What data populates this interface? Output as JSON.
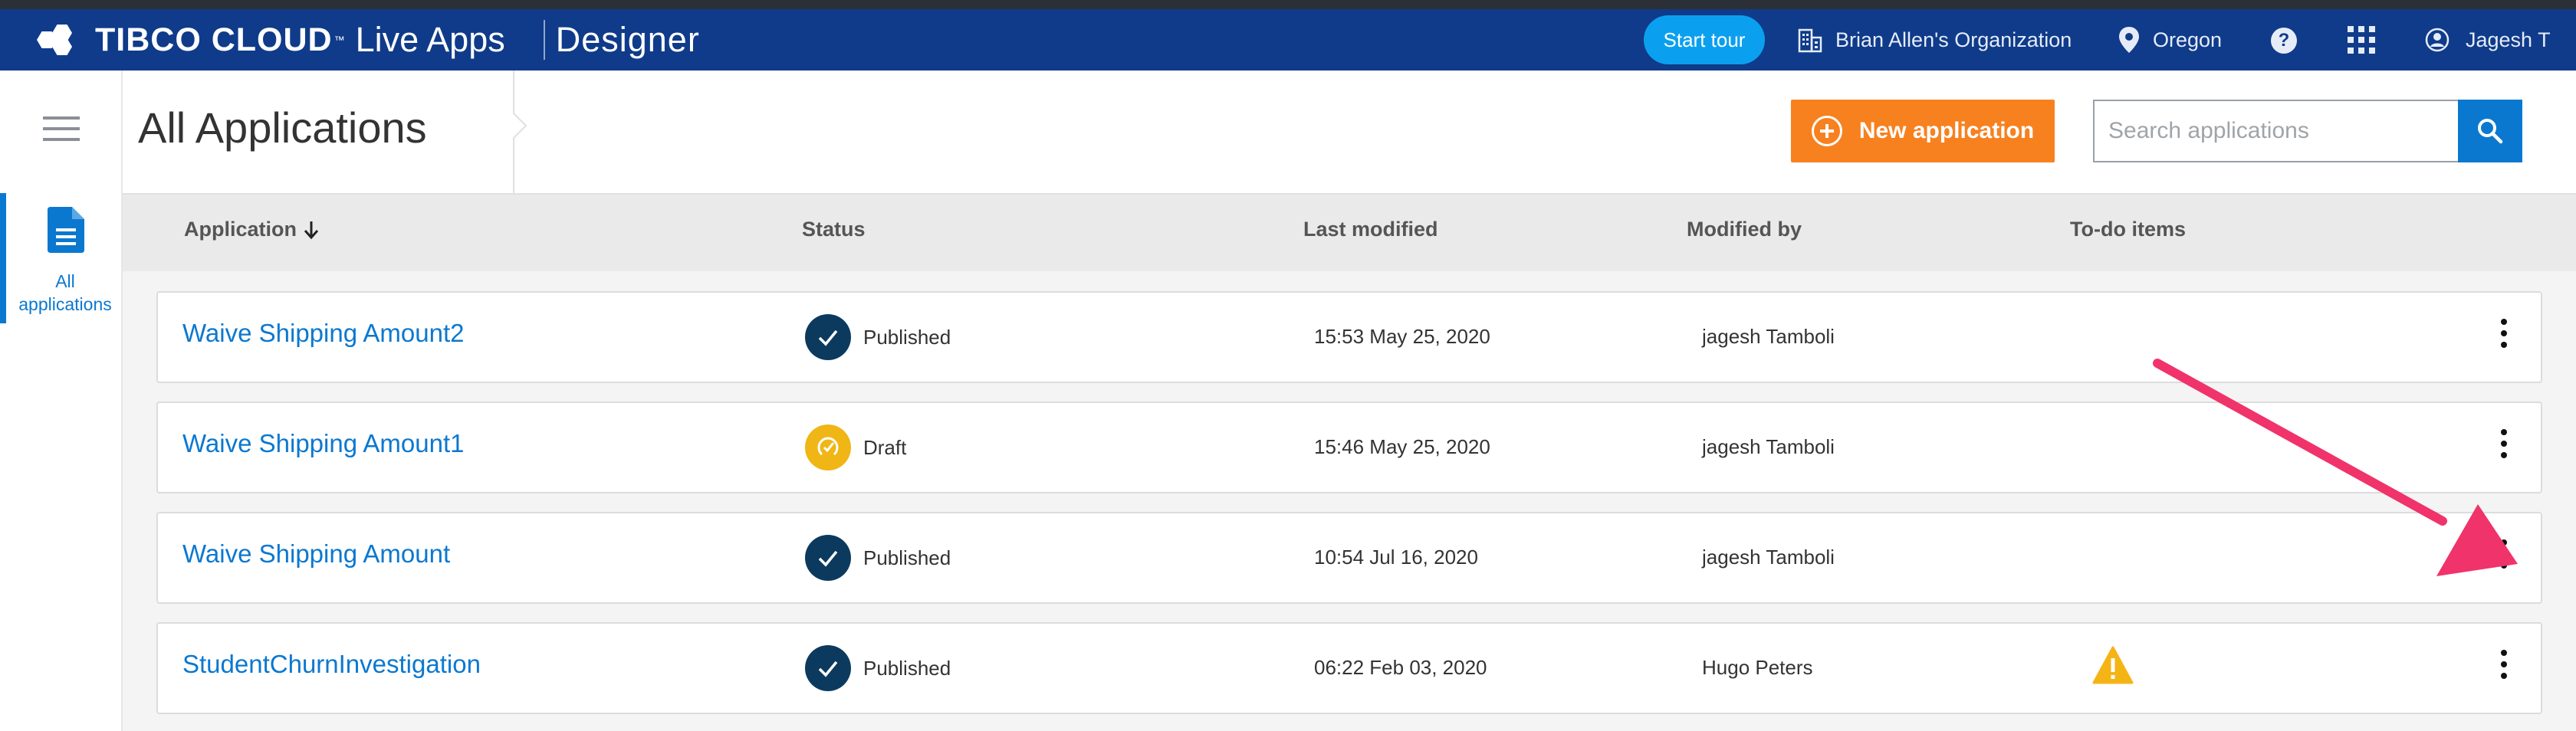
{
  "topbar": {
    "brand_name": "TIBCO CLOUD",
    "brand_tm": "™",
    "brand_sub": "Live Apps",
    "product": "Designer",
    "start_tour": "Start tour",
    "organization": "Brian Allen's Organization",
    "region": "Oregon",
    "help": "?",
    "user": "Jagesh T"
  },
  "sidebar": {
    "items": [
      {
        "label_line1": "All",
        "label_line2": "applications",
        "icon": "document-icon",
        "active": true
      }
    ]
  },
  "header": {
    "title": "All Applications",
    "new_application": "New application",
    "search_placeholder": "Search applications"
  },
  "table": {
    "columns": [
      "Application",
      "Status",
      "Last modified",
      "Modified by",
      "To-do items"
    ],
    "rows": [
      {
        "name": "Waive Shipping Amount2",
        "status": "Published",
        "status_type": "published",
        "modified": "15:53 May 25, 2020",
        "by": "jagesh Tamboli",
        "todo": ""
      },
      {
        "name": "Waive Shipping Amount1",
        "status": "Draft",
        "status_type": "draft",
        "modified": "15:46 May 25, 2020",
        "by": "jagesh Tamboli",
        "todo": ""
      },
      {
        "name": "Waive Shipping Amount",
        "status": "Published",
        "status_type": "published",
        "modified": "10:54 Jul 16, 2020",
        "by": "jagesh Tamboli",
        "todo": ""
      },
      {
        "name": "StudentChurnInvestigation",
        "status": "Published",
        "status_type": "published",
        "modified": "06:22 Feb 03, 2020",
        "by": "Hugo Peters",
        "todo": "warning-icon"
      }
    ]
  },
  "colors": {
    "topbar": "#0f3b8a",
    "accent": "#0b78d0",
    "new_button": "#f7811f",
    "published": "#0c3a5f",
    "draft": "#f0b616",
    "annotation_arrow": "#f0336a"
  }
}
